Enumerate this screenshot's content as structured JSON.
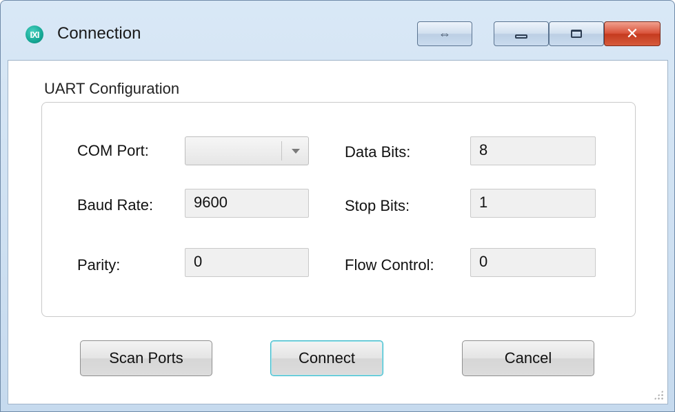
{
  "window": {
    "title": "Connection",
    "icon_text": "IXI",
    "caption_pin": "⇔",
    "caption_close": "✕"
  },
  "group": {
    "label": "UART Configuration"
  },
  "fields": {
    "com_port_label": "COM Port:",
    "com_port_value": "",
    "baud_rate_label": "Baud Rate:",
    "baud_rate_value": "9600",
    "parity_label": "Parity:",
    "parity_value": "0",
    "data_bits_label": "Data Bits:",
    "data_bits_value": "8",
    "stop_bits_label": "Stop Bits:",
    "stop_bits_value": "1",
    "flow_control_label": "Flow Control:",
    "flow_control_value": "0"
  },
  "buttons": {
    "scan": "Scan Ports",
    "connect": "Connect",
    "cancel": "Cancel"
  },
  "colors": {
    "accent_default_button": "#3cb7c8",
    "close_button": "#d9533b",
    "icon": "#15a895"
  }
}
